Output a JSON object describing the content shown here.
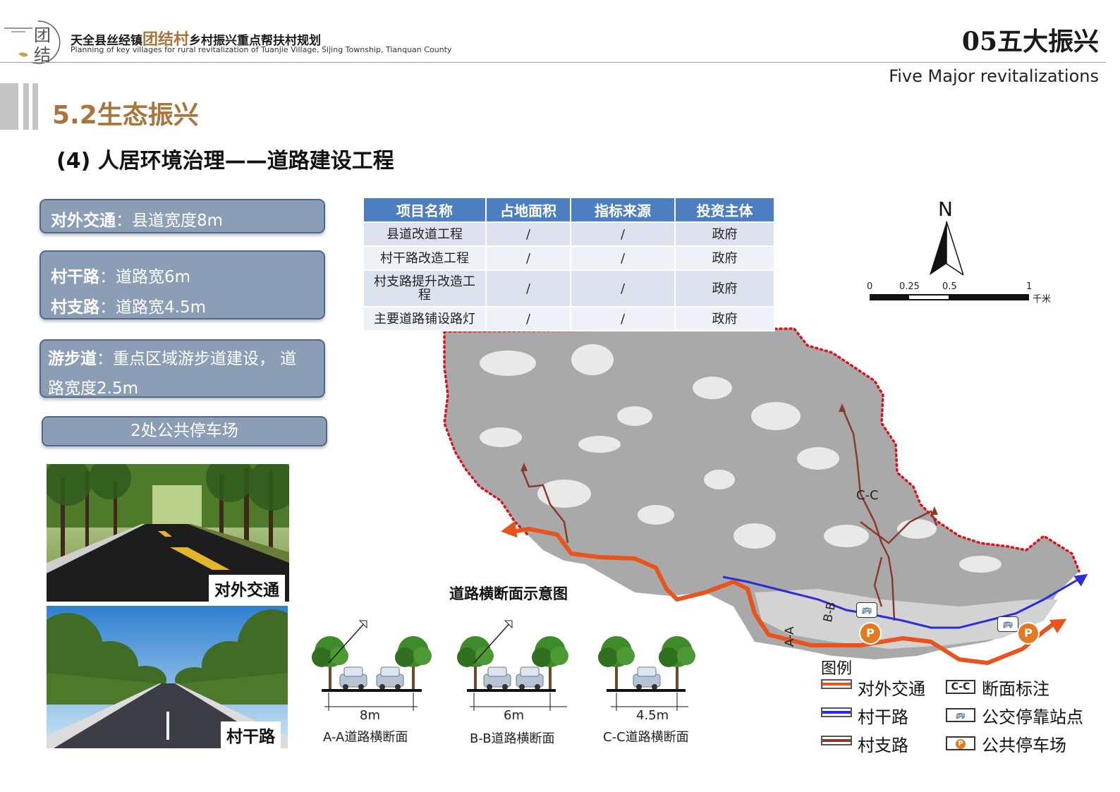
{
  "header": {
    "logo_chars": [
      "团",
      "结"
    ],
    "title_prefix": "天全县丝经镇",
    "title_highlight": "团结村",
    "title_suffix": "乡村振兴重点帮扶村规划",
    "subtitle": "Planning of key villages for rural revitalization of Tuanjie Village, Sijing Township, Tianquan County",
    "section_number": "05五大振兴",
    "section_en": "Five Major revitalizations"
  },
  "section": {
    "title": "5.2生态振兴",
    "subtitle": "(4) 人居环境治理——道路建设工程"
  },
  "boxes": {
    "external": {
      "key": "对外交通",
      "value": "：县道宽度8m"
    },
    "main_road": {
      "key": "村干路",
      "value": "：道路宽6m"
    },
    "branch_road": {
      "key": "村支路",
      "value": "：道路宽4.5m"
    },
    "walkway": {
      "key": "游步道",
      "value_line1": "：重点区域游步道建设，  道",
      "value_line2": "路宽度2.5m"
    },
    "parking": "2处公共停车场"
  },
  "photos": {
    "photo1_label": "对外交通",
    "photo2_label": "村干路"
  },
  "table": {
    "headers": [
      "项目名称",
      "占地面积",
      "指标来源",
      "投资主体"
    ],
    "rows": [
      [
        "县道改道工程",
        "/",
        "/",
        "政府"
      ],
      [
        "村干路改造工程",
        "/",
        "/",
        "政府"
      ],
      [
        "村支路提升改造工程",
        "/",
        "/",
        "政府"
      ],
      [
        "主要道路铺设路灯",
        "/",
        "/",
        "政府"
      ]
    ]
  },
  "map": {
    "north": "N",
    "scale_ticks": [
      "0",
      "0.25",
      "0.5",
      "1"
    ],
    "scale_unit": "千米",
    "section_labels": [
      "A-A",
      "B-B",
      "C-C"
    ],
    "parking_symbol": "P",
    "colors": {
      "external_road": "#e8541c",
      "main_road": "#2b2ed6",
      "branch_road": "#8b3a2a",
      "boundary": "#d9151b",
      "terrain": "#a9a9a9",
      "parking": "#e5791f"
    }
  },
  "legend": {
    "title": "图例",
    "items": {
      "external": "对外交通",
      "main": "村干路",
      "branch": "村支路",
      "section_mark": "断面标注",
      "section_symbol": "C-C",
      "bus": "公交停靠站点",
      "parking": "公共停车场"
    }
  },
  "cross_section": {
    "title": "道路横断面示意图",
    "sections": [
      {
        "width": "8m",
        "label": "A-A道路横断面"
      },
      {
        "width": "6m",
        "label": "B-B道路横断面"
      },
      {
        "width": "4.5m",
        "label": "C-C道路横断面"
      }
    ]
  }
}
